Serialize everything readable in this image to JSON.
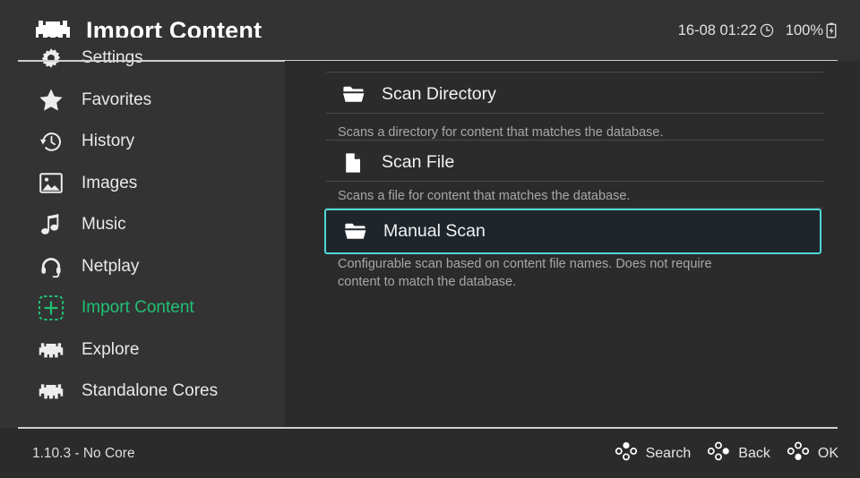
{
  "header": {
    "title": "Import Content",
    "logo_icon": "retroarch-logo-icon",
    "datetime": "16-08 01:22",
    "clock_icon": "clock-icon",
    "battery_percent": "100%",
    "battery_icon": "battery-charging-icon"
  },
  "sidebar": {
    "items": [
      {
        "label": "Settings",
        "icon": "gear-icon",
        "active": false
      },
      {
        "label": "Favorites",
        "icon": "star-icon",
        "active": false
      },
      {
        "label": "History",
        "icon": "history-icon",
        "active": false
      },
      {
        "label": "Images",
        "icon": "image-icon",
        "active": false
      },
      {
        "label": "Music",
        "icon": "music-note-icon",
        "active": false
      },
      {
        "label": "Netplay",
        "icon": "headset-icon",
        "active": false
      },
      {
        "label": "Import Content",
        "icon": "plus-box-icon",
        "active": true
      },
      {
        "label": "Explore",
        "icon": "invader-icon",
        "active": false
      },
      {
        "label": "Standalone Cores",
        "icon": "invader-icon",
        "active": false
      }
    ]
  },
  "main": {
    "entries": [
      {
        "label": "Scan Directory",
        "icon": "folder-icon",
        "description": "Scans a directory for content that matches the database.",
        "selected": false
      },
      {
        "label": "Scan File",
        "icon": "file-icon",
        "description": "Scans a file for content that matches the database.",
        "selected": false
      },
      {
        "label": "Manual Scan",
        "icon": "folder-icon",
        "description": "Configurable scan based on content file names. Does not require content to match the database.",
        "selected": true
      }
    ]
  },
  "footer": {
    "version": "1.10.3 - No Core",
    "actions": [
      {
        "label": "Search",
        "icon": "gamepad-button-up-icon"
      },
      {
        "label": "Back",
        "icon": "gamepad-button-right-icon"
      },
      {
        "label": "OK",
        "icon": "gamepad-button-down-icon"
      }
    ]
  },
  "colors": {
    "accent_green": "#21c074",
    "selection_cyan": "#4fd8d8",
    "selection_fill": "#1e262b",
    "sidebar_bg": "#333333",
    "content_bg": "#2b2b2b"
  }
}
